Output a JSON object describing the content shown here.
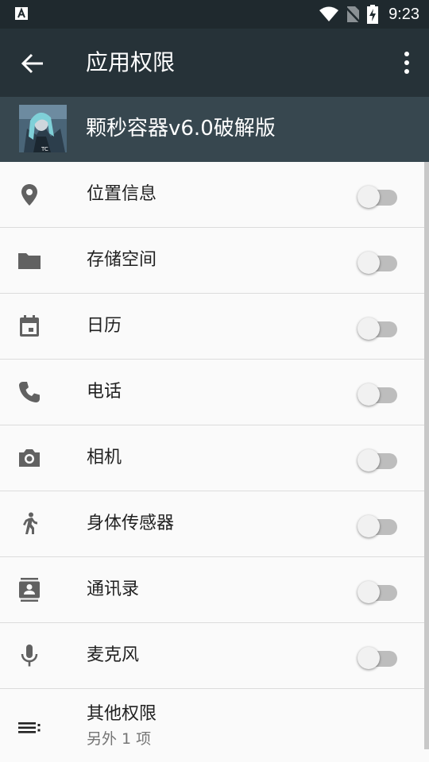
{
  "status_bar": {
    "time": "9:23"
  },
  "toolbar": {
    "title": "应用权限"
  },
  "app": {
    "name": "颗秒容器v6.0破解版"
  },
  "permissions": [
    {
      "label": "位置信息",
      "icon": "location-icon",
      "enabled": false
    },
    {
      "label": "存储空间",
      "icon": "folder-icon",
      "enabled": false
    },
    {
      "label": "日历",
      "icon": "calendar-icon",
      "enabled": false
    },
    {
      "label": "电话",
      "icon": "phone-icon",
      "enabled": false
    },
    {
      "label": "相机",
      "icon": "camera-icon",
      "enabled": false
    },
    {
      "label": "身体传感器",
      "icon": "walk-icon",
      "enabled": false
    },
    {
      "label": "通讯录",
      "icon": "contacts-icon",
      "enabled": false
    },
    {
      "label": "麦克风",
      "icon": "mic-icon",
      "enabled": false
    }
  ],
  "other": {
    "label": "其他权限",
    "sublabel": "另外 1 项",
    "icon": "list-icon"
  },
  "colors": {
    "statusbar": "#1f292e",
    "toolbar": "#263238",
    "app_header": "#37474f",
    "background": "#fafafa",
    "icon": "#616161"
  }
}
